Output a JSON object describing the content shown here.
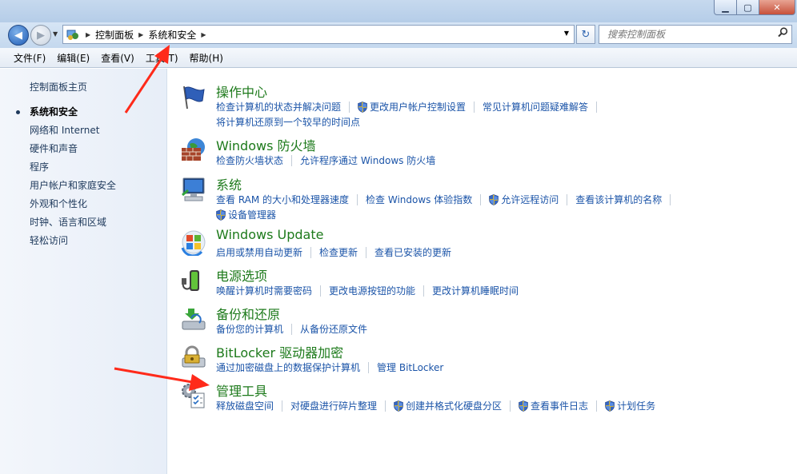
{
  "window": {
    "minimize_label": "▁",
    "maximize_label": "▢",
    "close_label": "✕"
  },
  "address_bar": {
    "breadcrumbs": [
      "控制面板",
      "系统和安全"
    ],
    "search_placeholder": "搜索控制面板"
  },
  "menu": {
    "items": [
      "文件(F)",
      "编辑(E)",
      "查看(V)",
      "工具(T)",
      "帮助(H)"
    ]
  },
  "sidebar": {
    "home": "控制面板主页",
    "items": [
      "系统和安全",
      "网络和 Internet",
      "硬件和声音",
      "程序",
      "用户帐户和家庭安全",
      "外观和个性化",
      "时钟、语言和区域",
      "轻松访问"
    ],
    "active_index": 0
  },
  "categories": [
    {
      "title": "操作中心",
      "icon": "flag-icon",
      "lines": [
        [
          {
            "text": "检查计算机的状态并解决问题",
            "shield": false
          },
          {
            "text": "更改用户帐户控制设置",
            "shield": true
          },
          {
            "text": "常见计算机问题疑难解答",
            "shield": false
          }
        ],
        [
          {
            "text": "将计算机还原到一个较早的时间点",
            "shield": false
          }
        ]
      ]
    },
    {
      "title": "Windows 防火墙",
      "icon": "firewall-icon",
      "lines": [
        [
          {
            "text": "检查防火墙状态",
            "shield": false
          },
          {
            "text": "允许程序通过 Windows 防火墙",
            "shield": false
          }
        ]
      ]
    },
    {
      "title": "系统",
      "icon": "computer-icon",
      "lines": [
        [
          {
            "text": "查看 RAM 的大小和处理器速度",
            "shield": false
          },
          {
            "text": "检查 Windows 体验指数",
            "shield": false
          },
          {
            "text": "允许远程访问",
            "shield": true
          },
          {
            "text": "查看该计算机的名称",
            "shield": false
          }
        ],
        [
          {
            "text": "设备管理器",
            "shield": true
          }
        ]
      ]
    },
    {
      "title": "Windows Update",
      "icon": "windows-update-icon",
      "lines": [
        [
          {
            "text": "启用或禁用自动更新",
            "shield": false
          },
          {
            "text": "检查更新",
            "shield": false
          },
          {
            "text": "查看已安装的更新",
            "shield": false
          }
        ]
      ]
    },
    {
      "title": "电源选项",
      "icon": "battery-icon",
      "lines": [
        [
          {
            "text": "唤醒计算机时需要密码",
            "shield": false
          },
          {
            "text": "更改电源按钮的功能",
            "shield": false
          },
          {
            "text": "更改计算机睡眠时间",
            "shield": false
          }
        ]
      ]
    },
    {
      "title": "备份和还原",
      "icon": "backup-icon",
      "lines": [
        [
          {
            "text": "备份您的计算机",
            "shield": false
          },
          {
            "text": "从备份还原文件",
            "shield": false
          }
        ]
      ]
    },
    {
      "title": "BitLocker 驱动器加密",
      "icon": "bitlocker-icon",
      "lines": [
        [
          {
            "text": "通过加密磁盘上的数据保护计算机",
            "shield": false
          },
          {
            "text": "管理 BitLocker",
            "shield": false
          }
        ]
      ]
    },
    {
      "title": "管理工具",
      "icon": "admin-tools-icon",
      "lines": [
        [
          {
            "text": "释放磁盘空间",
            "shield": false
          },
          {
            "text": "对硬盘进行碎片整理",
            "shield": false
          },
          {
            "text": "创建并格式化硬盘分区",
            "shield": true
          },
          {
            "text": "查看事件日志",
            "shield": true
          },
          {
            "text": "计划任务",
            "shield": true
          }
        ]
      ]
    }
  ],
  "colors": {
    "category_title": "#1d7a1b",
    "link": "#1b54a8",
    "annotation_arrow": "#ff2a1a"
  }
}
